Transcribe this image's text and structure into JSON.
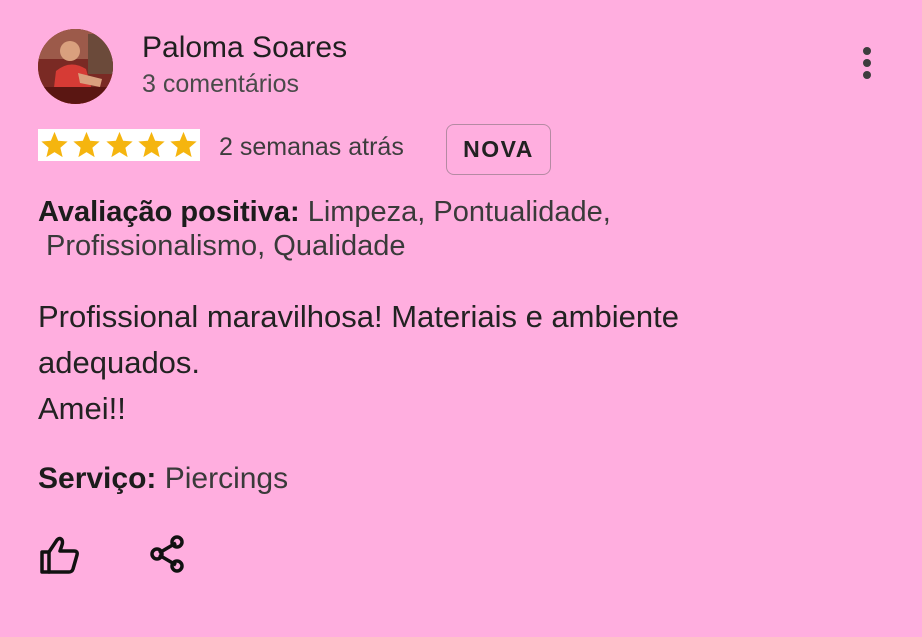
{
  "review": {
    "author": {
      "name": "Paloma Soares",
      "comment_count": "3 comentários"
    },
    "rating": {
      "stars": 5,
      "max_stars": 5,
      "color": "#f5b50f"
    },
    "time_ago": "2 semanas atrás",
    "badge": "NOVA",
    "positive": {
      "label": "Avaliação positiva:",
      "line1": " Limpeza, Pontualidade,",
      "line2": " Profissionalismo, Qualidade"
    },
    "text_lines": [
      "Profissional maravilhosa! Materiais e ambiente",
      "adequados.",
      "Amei!!"
    ],
    "service": {
      "label": "Serviço:",
      "value": " Piercings"
    },
    "actions": {
      "like_icon": "thumbs-up-icon",
      "share_icon": "share-icon",
      "menu_icon": "more-vertical-icon"
    },
    "colors": {
      "background": "#ffaedf",
      "star": "#f5b50f"
    }
  }
}
